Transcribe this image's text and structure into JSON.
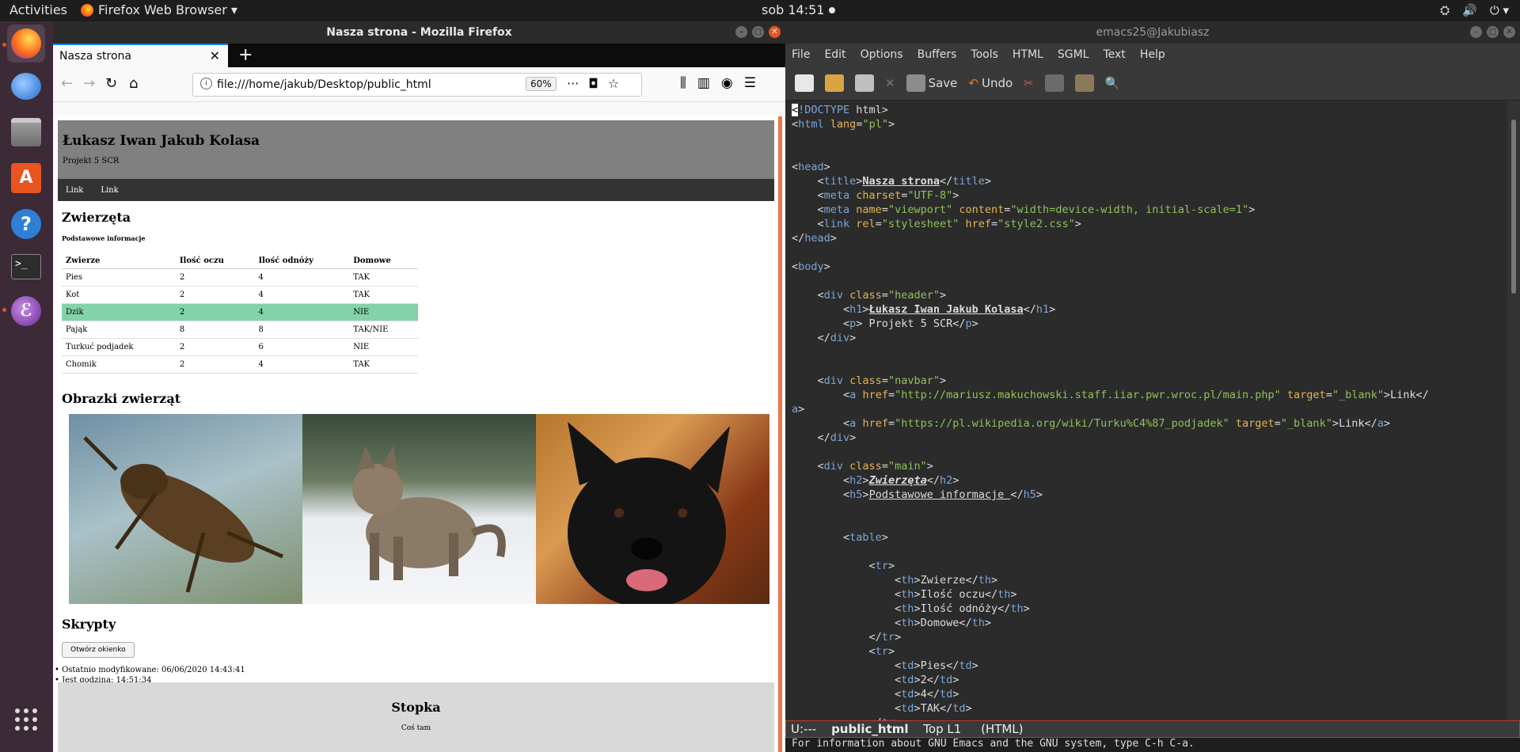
{
  "topbar": {
    "activities": "Activities",
    "app": "Firefox Web Browser ▾",
    "clock": "sob 14:51"
  },
  "firefox": {
    "window_title": "Nasza strona - Mozilla Firefox",
    "tab_title": "Nasza strona",
    "url": "file:///home/jakub/Desktop/public_html",
    "zoom": "60%",
    "page": {
      "header_title": "Łukasz Iwan Jakub Kolasa",
      "header_sub": "Projekt 5 SCR",
      "nav_links": [
        "Link",
        "Link"
      ],
      "h2": "Zwierzęta",
      "h5": "Podstawowe informacje",
      "table_headers": [
        "Zwierze",
        "Ilość oczu",
        "Ilość odnóży",
        "Domowe"
      ],
      "table_rows": [
        [
          "Pies",
          "2",
          "4",
          "TAK"
        ],
        [
          "Kot",
          "2",
          "4",
          "TAK"
        ],
        [
          "Dzik",
          "2",
          "4",
          "NIE"
        ],
        [
          "Pająk",
          "8",
          "8",
          "TAK/NIE"
        ],
        [
          "Turkuć podjadek",
          "2",
          "6",
          "NIE"
        ],
        [
          "Chomik",
          "2",
          "4",
          "TAK"
        ]
      ],
      "images_heading": "Obrazki zwierząt",
      "scripts_heading": "Skrypty",
      "open_window_button": "Otwórz okienko",
      "modified": "• Ostatnio modyfikowane: 06/06/2020 14:43:41",
      "time_now": "• Jest godzina: 14:51:34",
      "footer_title": "Stopka",
      "footer_text": "Coś tam"
    }
  },
  "emacs": {
    "window_title": "emacs25@Jakubiasz",
    "menu": [
      "File",
      "Edit",
      "Options",
      "Buffers",
      "Tools",
      "HTML",
      "SGML",
      "Text",
      "Help"
    ],
    "toolbar_save": "Save",
    "toolbar_undo": "Undo",
    "modeline_state": "U:---",
    "modeline_buffer": "public_html",
    "modeline_pos": "Top L1",
    "modeline_mode": "(HTML)",
    "echo": "For information about GNU Emacs and the GNU system, type C-h C-a."
  }
}
